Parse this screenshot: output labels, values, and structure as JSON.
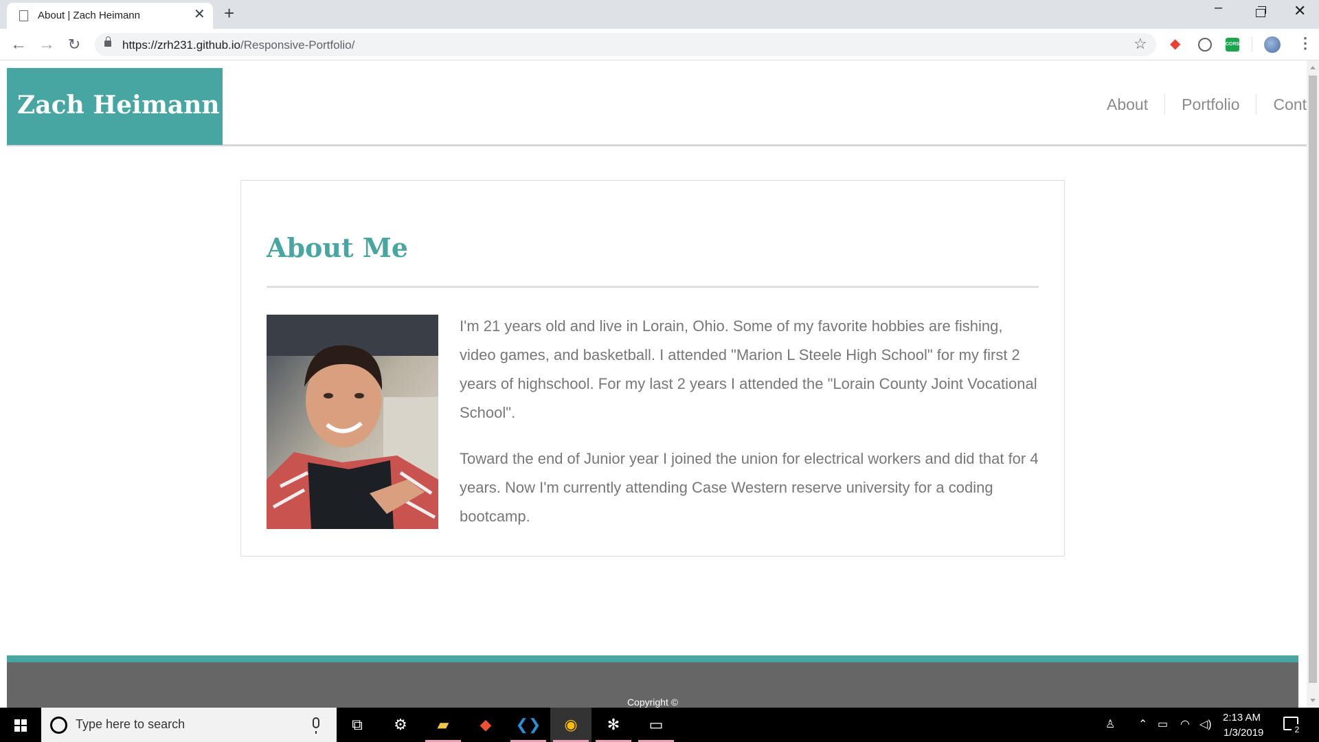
{
  "browser": {
    "tab_title": "About | Zach Heimann",
    "tab_close": "✕",
    "new_tab": "+",
    "url_host": "https://zrh231.github.io",
    "url_path": "/Responsive-Portfolio/",
    "ext_cors_label": "CORS"
  },
  "site": {
    "brand": "Zach Heimann",
    "nav": [
      "About",
      "Portfolio",
      "Contact"
    ],
    "accent_color": "#47a6a1"
  },
  "about": {
    "title": "About Me",
    "photo_alt": "Portrait photo of Zach Heimann",
    "paragraphs": [
      "I'm 21 years old and live in Lorain, Ohio. Some of my favorite hobbies are fishing, video games, and basketball. I attended \"Marion L Steele High School\" for my first 2 years of highschool. For my last 2 years I attended the \"Lorain County Joint Vocational School\".",
      "Toward the end of Junior year I joined the union for electrical workers and did that for 4 years. Now I'm currently attending Case Western reserve university for a coding bootcamp."
    ]
  },
  "footer": {
    "copyright": "Copyright ©"
  },
  "taskbar": {
    "search_placeholder": "Type here to search",
    "time": "2:13 AM",
    "date": "1/3/2019",
    "notification_count": "2",
    "apps": [
      "task-view",
      "steam",
      "file-explorer",
      "git",
      "vs-code",
      "chrome",
      "slack",
      "terminal"
    ]
  }
}
